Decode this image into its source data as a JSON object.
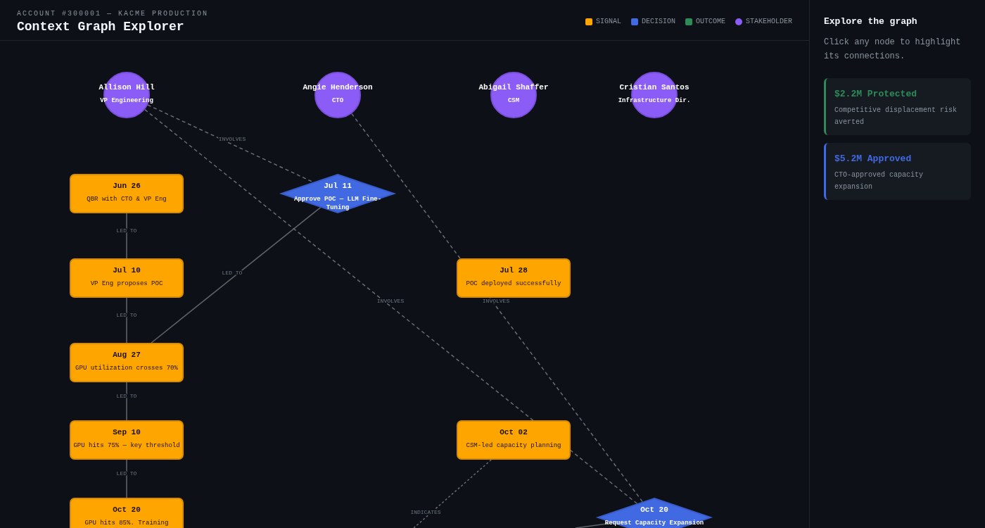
{
  "header": {
    "account": "ACCOUNT #300001 — KACME PRODUCTION",
    "title": "Context Graph Explorer",
    "legend": [
      {
        "kind": "signal",
        "label": "SIGNAL",
        "color": "#ffa500"
      },
      {
        "kind": "decision",
        "label": "DECISION",
        "color": "#4169e1"
      },
      {
        "kind": "outcome",
        "label": "OUTCOME",
        "color": "#2e8b57"
      },
      {
        "kind": "stakeholder",
        "label": "STAKEHOLDER",
        "color": "#8b5cf6"
      }
    ]
  },
  "graph": {
    "nodes": [
      {
        "kind": "stakeholder",
        "name": "Allison Hill",
        "role": "VP Engineering"
      },
      {
        "kind": "stakeholder",
        "name": "Angie Henderson",
        "role": "CTO"
      },
      {
        "kind": "stakeholder",
        "name": "Abigail Shaffer",
        "role": "CSM"
      },
      {
        "kind": "stakeholder",
        "name": "Cristian Santos",
        "role": "Infrastructure Dir."
      },
      {
        "kind": "signal",
        "date": "Jun 26",
        "text": "QBR with CTO & VP Eng"
      },
      {
        "kind": "decision",
        "date": "Jul 11",
        "text": "Approve POC — LLM Fine-Tuning"
      },
      {
        "kind": "signal",
        "date": "Jul 10",
        "text": "VP Eng proposes POC"
      },
      {
        "kind": "signal",
        "date": "Jul 28",
        "text": "POC deployed successfully"
      },
      {
        "kind": "signal",
        "date": "Aug 27",
        "text": "GPU utilization crosses 70%"
      },
      {
        "kind": "signal",
        "date": "Sep 10",
        "text": "GPU hits 75% — key threshold"
      },
      {
        "kind": "signal",
        "date": "Oct 02",
        "text": "CSM-led capacity planning"
      },
      {
        "kind": "signal",
        "date": "Oct 20",
        "text": "GPU hits 85%. Training"
      },
      {
        "kind": "decision",
        "date": "Oct 20",
        "text": "Request Capacity Expansion"
      }
    ],
    "edges": [
      {
        "kind": "involves",
        "label": "INVOLVES"
      },
      {
        "kind": "led_to",
        "label": "LED TO"
      },
      {
        "kind": "led_to",
        "label": "LED TO"
      },
      {
        "kind": "involves",
        "label": "INVOLVES"
      },
      {
        "kind": "involves",
        "label": "INVOLVES"
      },
      {
        "kind": "led_to",
        "label": "LED TO"
      },
      {
        "kind": "led_to",
        "label": "LED TO"
      },
      {
        "kind": "led_to",
        "label": "LED TO"
      },
      {
        "kind": "indicates",
        "label": "INDICATES"
      },
      {
        "kind": "led_to"
      }
    ]
  },
  "sidebar": {
    "title": "Explore the graph",
    "hint": "Click any node to highlight its connections.",
    "cards": [
      {
        "title": "$2.2M Protected",
        "text": "Competitive displacement risk averted",
        "color": "#2e8b57"
      },
      {
        "title": "$5.2M Approved",
        "text": "CTO-approved capacity expansion",
        "color": "#4169e1"
      }
    ]
  }
}
